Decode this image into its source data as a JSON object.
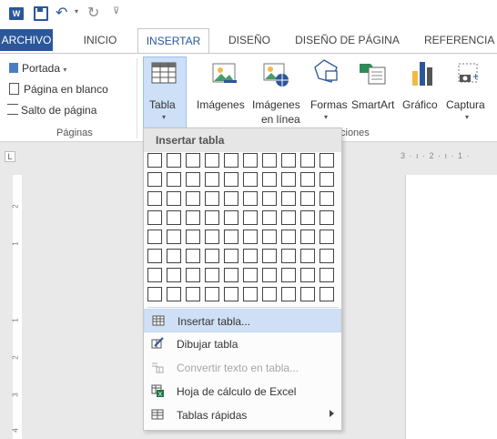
{
  "tabs": [
    {
      "label": "ARCHIVO"
    },
    {
      "label": "INICIO"
    },
    {
      "label": "INSERTAR"
    },
    {
      "label": "DISEÑO"
    },
    {
      "label": "DISEÑO DE PÁGINA"
    },
    {
      "label": "REFERENCIA"
    }
  ],
  "paginas_group": {
    "label": "Páginas",
    "items": [
      {
        "label": "Portada",
        "icon": "cover-page-icon"
      },
      {
        "label": "Página en blanco",
        "icon": "blank-page-icon"
      },
      {
        "label": "Salto de página",
        "icon": "page-break-icon"
      }
    ]
  },
  "ribbon": {
    "tabla_label": "Tabla",
    "imagenes_label": "Imágenes",
    "imagenes_linea_label1": "Imágenes",
    "imagenes_linea_label2": "en línea",
    "formas_label": "Formas",
    "smartart_label": "SmartArt",
    "grafico_label": "Gráfico",
    "captura_label": "Captura",
    "ilustraciones_partial": "ciones"
  },
  "ruler": {
    "partial": "3 · ı · 2 · ı · 1 ·"
  },
  "left_ruler": [
    "2",
    "1",
    "1",
    "2",
    "3",
    "4"
  ],
  "dropdown": {
    "header": "Insertar tabla",
    "grid_cols": 10,
    "grid_rows": 8,
    "items": [
      {
        "label": "Insertar tabla...",
        "icon": "insert-table-icon",
        "highlighted": true,
        "disabled": false
      },
      {
        "label": "Dibujar tabla",
        "icon": "draw-table-icon",
        "highlighted": false,
        "disabled": false
      },
      {
        "label": "Convertir texto en tabla...",
        "icon": "convert-text-table-icon",
        "highlighted": false,
        "disabled": true
      },
      {
        "label": "Hoja de cálculo de Excel",
        "icon": "excel-sheet-icon",
        "highlighted": false,
        "disabled": false
      },
      {
        "label": "Tablas rápidas",
        "icon": "quick-tables-icon",
        "highlighted": false,
        "disabled": false,
        "submenu": true
      }
    ]
  },
  "colors": {
    "accent": "#2b579a",
    "highlight": "#cfe0f6"
  }
}
